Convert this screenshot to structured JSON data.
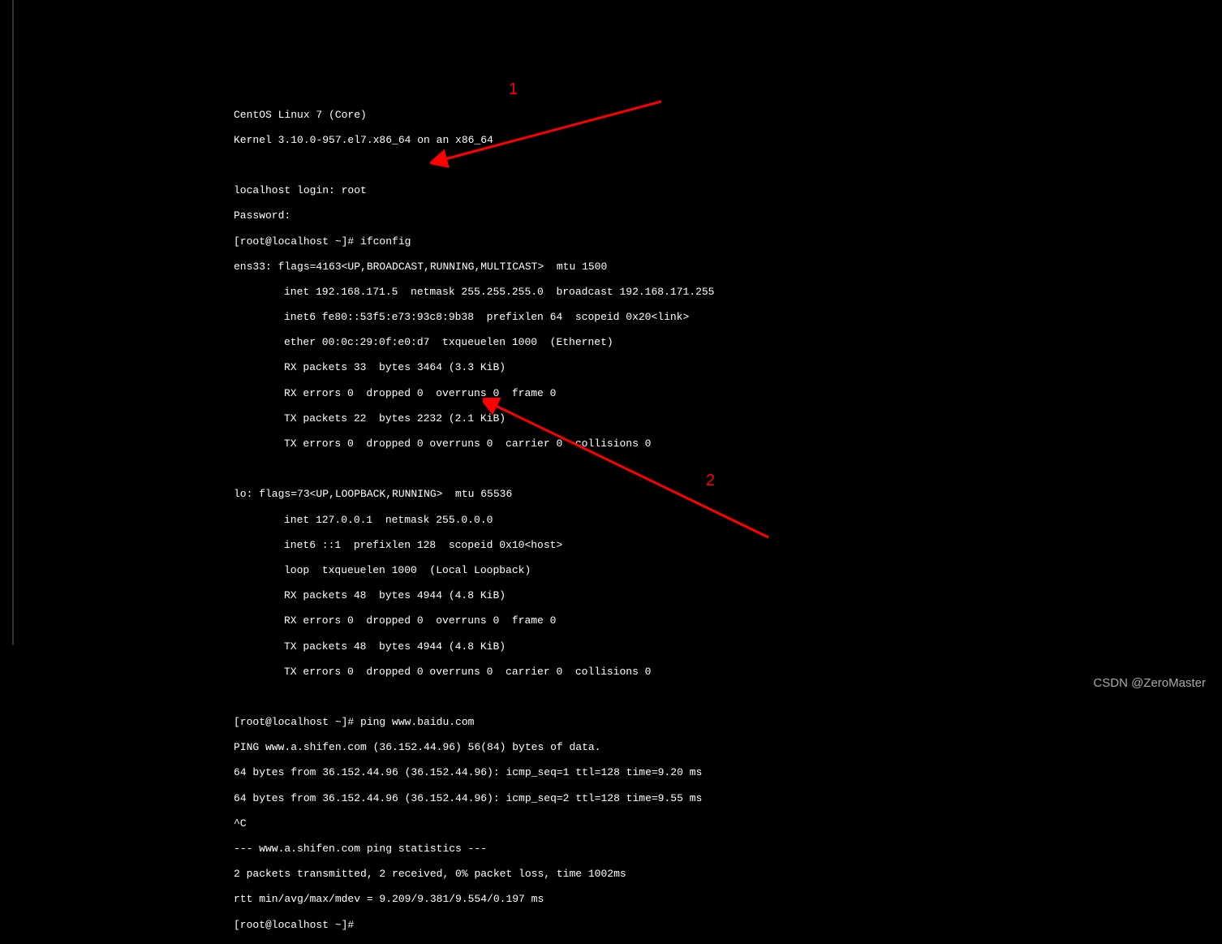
{
  "terminal": {
    "header1": "CentOS Linux 7 (Core)",
    "header2": "Kernel 3.10.0-957.el7.x86_64 on an x86_64",
    "login_prompt": "localhost login: root",
    "password_prompt": "Password:",
    "prompt1": "[root@localhost ~]# ifconfig",
    "ens33_line": "ens33: flags=4163<UP,BROADCAST,RUNNING,MULTICAST>  mtu 1500",
    "ens33_inet": "inet 192.168.171.5  netmask 255.255.255.0  broadcast 192.168.171.255",
    "ens33_inet6": "inet6 fe80::53f5:e73:93c8:9b38  prefixlen 64  scopeid 0x20<link>",
    "ens33_ether": "ether 00:0c:29:0f:e0:d7  txqueuelen 1000  (Ethernet)",
    "ens33_rx_packets": "RX packets 33  bytes 3464 (3.3 KiB)",
    "ens33_rx_errors": "RX errors 0  dropped 0  overruns 0  frame 0",
    "ens33_tx_packets": "TX packets 22  bytes 2232 (2.1 KiB)",
    "ens33_tx_errors": "TX errors 0  dropped 0 overruns 0  carrier 0  collisions 0",
    "lo_line": "lo: flags=73<UP,LOOPBACK,RUNNING>  mtu 65536",
    "lo_inet": "inet 127.0.0.1  netmask 255.0.0.0",
    "lo_inet6": "inet6 ::1  prefixlen 128  scopeid 0x10<host>",
    "lo_loop": "loop  txqueuelen 1000  (Local Loopback)",
    "lo_rx_packets": "RX packets 48  bytes 4944 (4.8 KiB)",
    "lo_rx_errors": "RX errors 0  dropped 0  overruns 0  frame 0",
    "lo_tx_packets": "TX packets 48  bytes 4944 (4.8 KiB)",
    "lo_tx_errors": "TX errors 0  dropped 0 overruns 0  carrier 0  collisions 0",
    "prompt2": "[root@localhost ~]# ping www.baidu.com",
    "ping_header": "PING www.a.shifen.com (36.152.44.96) 56(84) bytes of data.",
    "ping1": "64 bytes from 36.152.44.96 (36.152.44.96): icmp_seq=1 ttl=128 time=9.20 ms",
    "ping2": "64 bytes from 36.152.44.96 (36.152.44.96): icmp_seq=2 ttl=128 time=9.55 ms",
    "ctrlc": "^C",
    "ping_stats_header": "--- www.a.shifen.com ping statistics ---",
    "ping_stats1": "2 packets transmitted, 2 received, 0% packet loss, time 1002ms",
    "ping_stats2": "rtt min/avg/max/mdev = 9.209/9.381/9.554/0.197 ms",
    "prompt3": "[root@localhost ~]# "
  },
  "annotations": {
    "label1": "1",
    "label2": "2"
  },
  "watermark": "CSDN @ZeroMaster"
}
